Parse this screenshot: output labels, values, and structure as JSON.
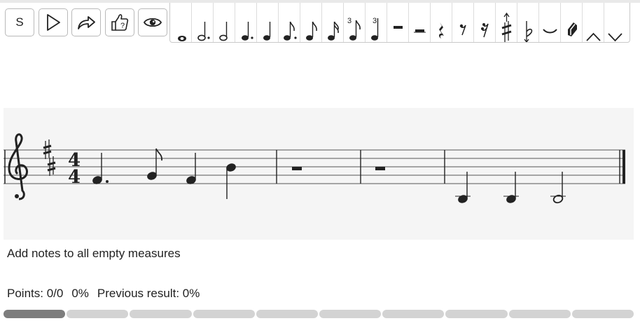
{
  "toolbar": {
    "buttons": [
      {
        "name": "settings-s-button",
        "label": "S"
      },
      {
        "name": "play-button",
        "icon": "play-icon"
      },
      {
        "name": "share-button",
        "icon": "share-arrow-icon"
      },
      {
        "name": "hint-button",
        "icon": "thumb-question-icon"
      },
      {
        "name": "show-solution-button",
        "icon": "eye-icon"
      }
    ]
  },
  "palette": {
    "items": [
      {
        "icon": "whole-note-icon"
      },
      {
        "icon": "dotted-half-note-icon"
      },
      {
        "icon": "half-note-icon"
      },
      {
        "icon": "dotted-quarter-note-icon"
      },
      {
        "icon": "quarter-note-icon"
      },
      {
        "icon": "dotted-eighth-note-icon"
      },
      {
        "icon": "eighth-note-icon"
      },
      {
        "icon": "sixteenth-note-icon"
      },
      {
        "icon": "eighth-triplet-icon",
        "label": "3"
      },
      {
        "icon": "quarter-triplet-icon",
        "label": "3"
      },
      {
        "icon": "whole-rest-icon"
      },
      {
        "icon": "half-rest-icon"
      },
      {
        "icon": "quarter-rest-icon"
      },
      {
        "icon": "eighth-rest-icon"
      },
      {
        "icon": "sixteenth-rest-icon"
      },
      {
        "icon": "sharp-up-icon"
      },
      {
        "icon": "flat-down-icon"
      },
      {
        "icon": "tie-icon"
      },
      {
        "icon": "eraser-icon"
      },
      {
        "icon": "chevron-up-icon"
      },
      {
        "icon": "chevron-down-icon"
      }
    ]
  },
  "score": {
    "clef": "treble",
    "key_signature": "D major (2 sharps)",
    "time_signature": {
      "top": "4",
      "bottom": "4"
    },
    "measures": [
      {
        "notes": [
          "dotted-quarter F#4",
          "eighth G4",
          "quarter F#4",
          "quarter D5"
        ]
      },
      {
        "notes": [
          "whole rest"
        ]
      },
      {
        "notes": [
          "whole rest"
        ]
      },
      {
        "notes": [
          "quarter A3",
          "quarter A3",
          "half A3"
        ]
      }
    ]
  },
  "instruction": "Add notes to all empty measures",
  "status": {
    "points": "Points: 0/0",
    "percent": "0%",
    "previous": "Previous result: 0%"
  },
  "progress": {
    "total": 10,
    "completed": 1
  }
}
